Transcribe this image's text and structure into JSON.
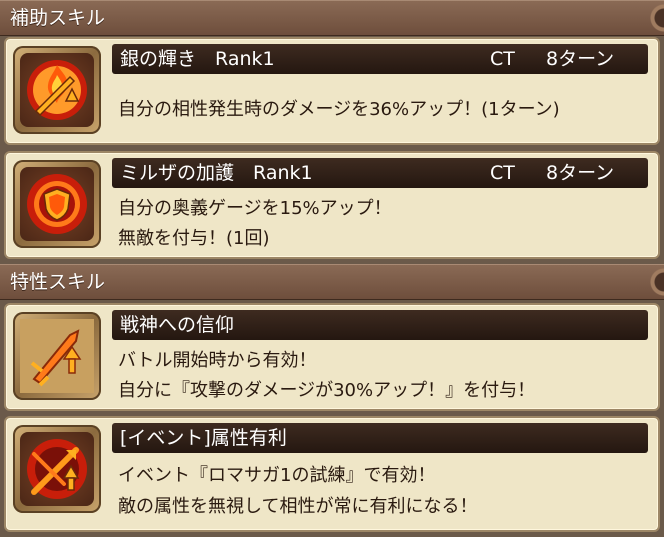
{
  "sections": {
    "support": {
      "title": "補助スキル"
    },
    "trait": {
      "title": "特性スキル"
    }
  },
  "skills": [
    {
      "name": "銀の輝き",
      "rank": "Rank1",
      "ct_label": "CT",
      "ct_value": "8ターン",
      "lines": [
        "自分の相性発生時のダメージを36%アップ！(1ターン)"
      ],
      "icon": "flame-sword-icon"
    },
    {
      "name": "ミルザの加護",
      "rank": "Rank1",
      "ct_label": "CT",
      "ct_value": "8ターン",
      "lines": [
        "自分の奥義ゲージを15%アップ！",
        "無敵を付与！(1回)"
      ],
      "icon": "shield-icon"
    },
    {
      "name": "戦神への信仰",
      "lines": [
        "バトル開始時から有効！",
        "自分に『攻撃のダメージが30%アップ！』を付与！"
      ],
      "icon": "sword-up-icon"
    },
    {
      "name": "[イベント]属性有利",
      "lines": [
        "イベント『ロマサガ1の試練』で有効！",
        "敵の属性を無視して相性が常に有利になる！"
      ],
      "icon": "crossed-arrows-icon"
    }
  ],
  "colors": {
    "header_bg": "#7a5a46",
    "card_bg": "#efe6c7",
    "name_bar": "#2e1f16",
    "icon_orange": "#ff7a1a",
    "icon_red": "#c81e0a"
  }
}
